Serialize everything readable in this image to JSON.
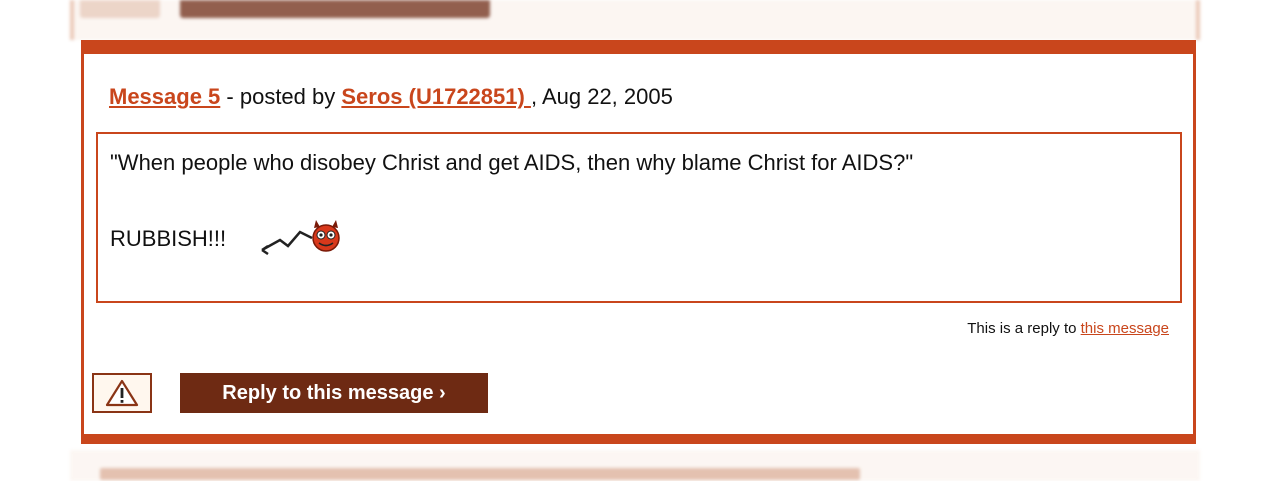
{
  "message": {
    "title_link": "Message 5",
    "posted_by_text": " - posted by ",
    "author_link": "Seros (U1722851) ",
    "date_text": ", Aug 22, 2005",
    "body_line1": "\"When people who disobey Christ and get AIDS, then why blame Christ for AIDS?\"",
    "body_line2": "RUBBISH!!!",
    "smiley_icon": "devil-smiley-icon",
    "reply_prefix": "This is a reply to ",
    "reply_link": "this message",
    "reply_button": "Reply to this message ›",
    "warn_icon": "warning-triangle-icon"
  },
  "colors": {
    "accent": "#c9461c",
    "button_bg": "#6e2a13"
  }
}
